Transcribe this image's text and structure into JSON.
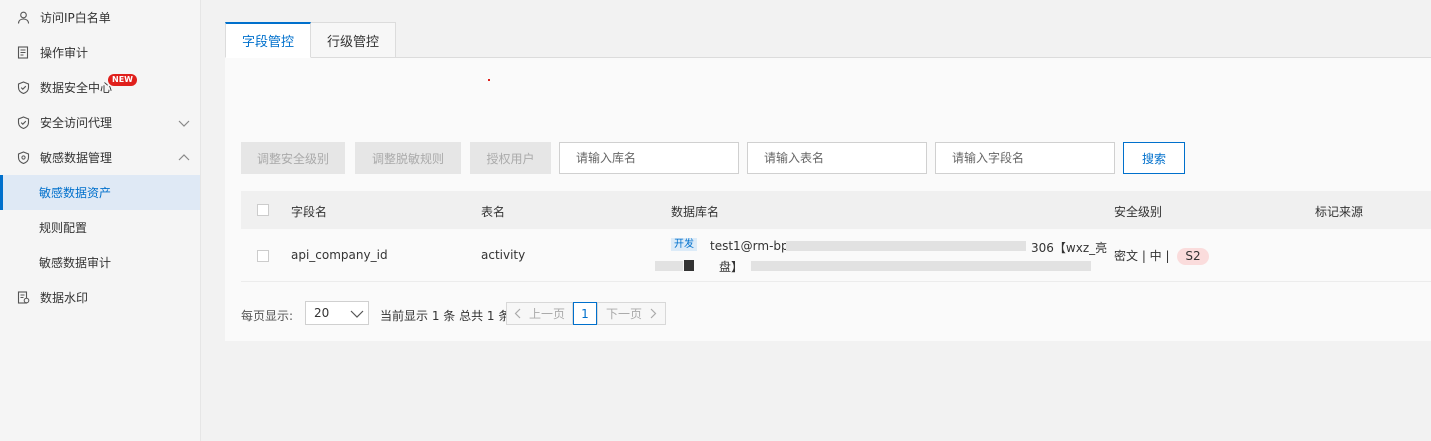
{
  "sidebar": {
    "items": [
      {
        "label": "访问IP白名单",
        "icon": "user-icon"
      },
      {
        "label": "操作审计",
        "icon": "audit-log-icon"
      },
      {
        "label": "数据安全中心",
        "icon": "shield-check-icon",
        "badge": "NEW"
      },
      {
        "label": "安全访问代理",
        "icon": "shield-check-icon"
      },
      {
        "label": "敏感数据管理",
        "icon": "eye-shield-icon"
      },
      {
        "label": "敏感数据资产"
      },
      {
        "label": "规则配置"
      },
      {
        "label": "敏感数据审计"
      },
      {
        "label": "数据水印",
        "icon": "watermark-icon"
      }
    ]
  },
  "tabs": [
    {
      "label": "字段管控",
      "active": true
    },
    {
      "label": "行级管控",
      "active": false
    }
  ],
  "toolbar": {
    "adjust_level": "调整安全级别",
    "adjust_mask": "调整脱敏规则",
    "grant_user": "授权用户",
    "db_placeholder": "请输入库名",
    "table_placeholder": "请输入表名",
    "field_placeholder": "请输入字段名",
    "search": "搜索"
  },
  "table": {
    "columns": [
      "字段名",
      "表名",
      "数据库名",
      "安全级别",
      "标记来源"
    ],
    "rows": [
      {
        "field": "api_company_id",
        "table": "activity",
        "env_tag": "开发",
        "db_prefix": "test1@rm-bp1",
        "db_suffix": "306【wxz_亮",
        "db_line2": "盘】",
        "level_text": "密文 | 中 |",
        "level_badge": "S2",
        "source": ""
      }
    ]
  },
  "pagination": {
    "per_page_label": "每页显示:",
    "per_page_value": "20",
    "info": "当前显示 1 条 总共 1 条",
    "prev": "上一页",
    "current": "1",
    "next": "下一页"
  },
  "colors": {
    "accent": "#0070cc",
    "badge_new": "#e0201c",
    "s2_pill": "#fadcdc"
  }
}
